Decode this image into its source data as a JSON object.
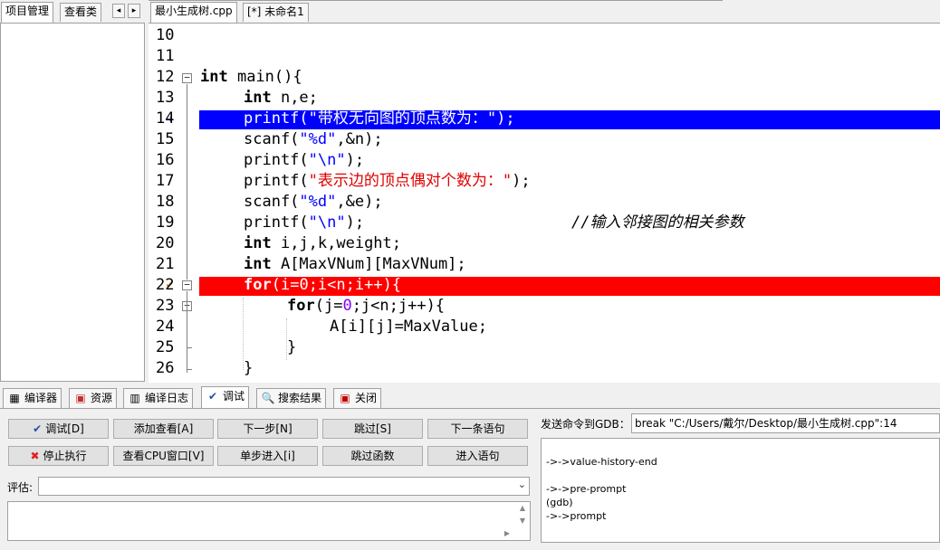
{
  "left_panel": {
    "tabs": [
      "项目管理",
      "查看类"
    ],
    "arrow_left": "◂",
    "arrow_right": "▸"
  },
  "editor_tabs": [
    "最小生成树.cpp",
    "[*] 未命名1"
  ],
  "code": {
    "lines": [
      {
        "n": "10"
      },
      {
        "n": "11"
      },
      {
        "n": "12"
      },
      {
        "n": "13"
      },
      {
        "n": "14"
      },
      {
        "n": "15"
      },
      {
        "n": "16"
      },
      {
        "n": "17"
      },
      {
        "n": "18"
      },
      {
        "n": "19"
      },
      {
        "n": "20"
      },
      {
        "n": "21"
      },
      {
        "n": "22"
      },
      {
        "n": "23"
      },
      {
        "n": "24"
      },
      {
        "n": "25"
      },
      {
        "n": "26"
      }
    ],
    "tokens": {
      "l12_kw": "int",
      "l12_rest": " main(){",
      "l13_kw": "int",
      "l13_rest": " n,e;",
      "l14_a": "printf(",
      "l14_str": "\"带权无向图的顶点数为：\"",
      "l14_b": ");",
      "l15_a": "scanf(",
      "l15_str": "\"%d\"",
      "l15_b": ",&n);",
      "l16_a": "printf(",
      "l16_str": "\"\\n\"",
      "l16_b": ");",
      "l17_a": "printf(",
      "l17_str": "\"表示边的顶点偶对个数为：\"",
      "l17_b": ");",
      "l18_a": "scanf(",
      "l18_str": "\"%d\"",
      "l18_b": ",&e);",
      "l19_a": "printf(",
      "l19_str": "\"\\n\"",
      "l19_b": ");",
      "l19_cmt": "//输入邻接图的相关参数",
      "l20_kw": "int",
      "l20_rest": " i,j,k,weight;",
      "l21_kw": "int",
      "l21_rest": " A[MaxVNum][MaxVNum];",
      "l22_kw": "for",
      "l22_a": "(i=",
      "l22_n": "0",
      "l22_b": ";i<n;i++){",
      "l23_kw": "for",
      "l23_a": "(j=",
      "l23_n": "0",
      "l23_b": ";j<n;j++){",
      "l24": "A[i][j]=MaxValue;",
      "l25": "}",
      "l26": "}"
    }
  },
  "bottom_tabs": [
    {
      "label": "编译器",
      "icon": "compiler-icon"
    },
    {
      "label": "资源",
      "icon": "resources-icon"
    },
    {
      "label": "编译日志",
      "icon": "compile-log-icon"
    },
    {
      "label": "调试",
      "icon": "debug-check-icon"
    },
    {
      "label": "搜索结果",
      "icon": "search-results-icon"
    },
    {
      "label": "关闭",
      "icon": "close-panel-icon"
    }
  ],
  "debug": {
    "buttons_row1": [
      "调试[D]",
      "添加查看[A]",
      "下一步[N]",
      "跳过[S]",
      "下一条语句"
    ],
    "buttons_row2": [
      "停止执行",
      "查看CPU窗口[V]",
      "单步进入[i]",
      "跳过函数",
      "进入语句"
    ],
    "eval_label": "评估:",
    "gdb_label": "发送命令到GDB：",
    "gdb_command": "break \"C:/Users/戴尔/Desktop/最小生成树.cpp\":14",
    "gdb_output": [
      "->->value-history-end",
      "",
      "->->pre-prompt",
      "(gdb)",
      "->->prompt"
    ]
  },
  "colors": {
    "current_line": "#0000ff",
    "breakpoint_line": "#ff0000",
    "string": "#0000ff",
    "string_cn": "#e00000",
    "comment": "#3388cc"
  }
}
